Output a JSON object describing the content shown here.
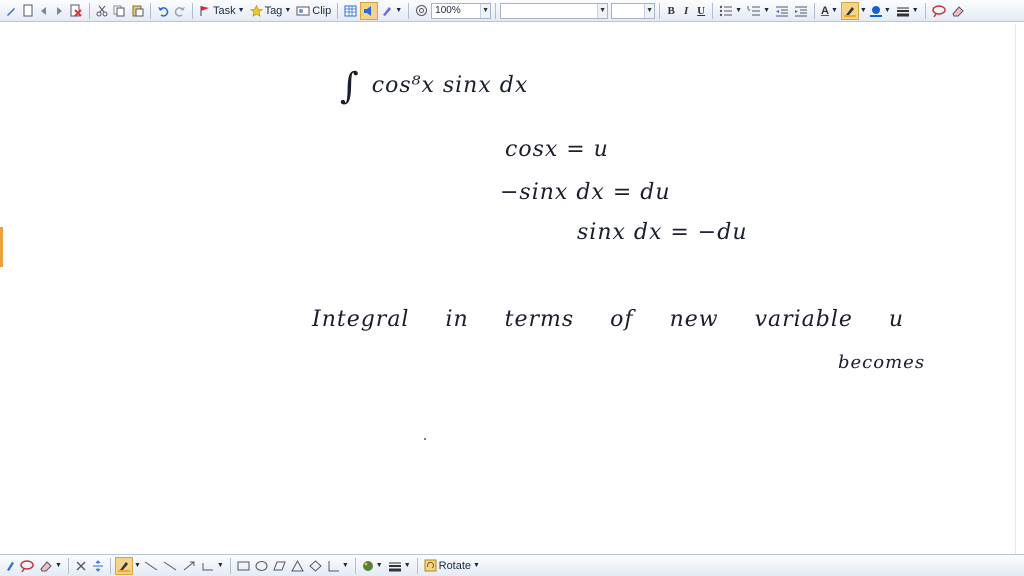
{
  "toolbar": {
    "task_label": "Task",
    "tag_label": "Tag",
    "clip_label": "Clip",
    "zoom_value": "100%",
    "font_name_value": "",
    "font_size_value": "",
    "bold_label": "B",
    "italic_label": "I",
    "underline_label": "U",
    "font_color_label": "A",
    "accent_color": "#f0a030",
    "highlight_color": "#f5a623",
    "font_color": "#1a5fd0"
  },
  "canvas": {
    "line1": "cos⁸x sinx dx",
    "integral_sign": "∫",
    "line2": "cosx  =  u",
    "line3": "−sinx dx  = du",
    "line4": "sinx dx  =  −du",
    "line5": "Integral in terms of new variable u",
    "line6": "becomes"
  },
  "bottombar": {
    "rotate_label": "Rotate"
  },
  "icons": [
    "page-icon",
    "back-icon",
    "forward-icon",
    "delete-icon",
    "cut-icon",
    "copy-icon",
    "paste-icon",
    "undo-icon",
    "redo-icon",
    "flag-icon",
    "star-icon",
    "clip-icon",
    "table-icon",
    "pen-icon",
    "attach-icon",
    "bullets-icon",
    "numbering-icon",
    "outdent-icon",
    "indent-icon",
    "highlighter-icon",
    "lasso-icon",
    "eraser-icon",
    "line-icon",
    "shape-icon",
    "color-icon"
  ]
}
